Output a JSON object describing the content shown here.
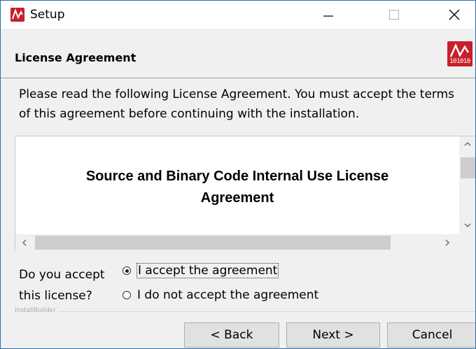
{
  "window": {
    "title": "Setup",
    "icon": "app-logo-icon",
    "controls": [
      "minimize-icon",
      "maximize-icon",
      "close-icon"
    ]
  },
  "header": {
    "title": "License Agreement",
    "logo_text": "101010"
  },
  "intro_text": "Please read the following License Agreement. You must accept the terms of this agreement before continuing with the installation.",
  "license": {
    "heading_line1": "Source and Binary Code Internal Use License",
    "heading_line2": "Agreement"
  },
  "accept": {
    "question_line1": "Do you accept",
    "question_line2": "this license?",
    "options": [
      {
        "label": "I accept the agreement",
        "selected": true
      },
      {
        "label": "I do not accept the agreement",
        "selected": false
      }
    ]
  },
  "footer": {
    "brand": "InstallBuilder",
    "back_label": "< Back",
    "next_label": "Next >",
    "cancel_label": "Cancel"
  },
  "colors": {
    "accent": "#c8202a",
    "window_border": "#1f6fb4",
    "background": "#f0f0f0"
  }
}
